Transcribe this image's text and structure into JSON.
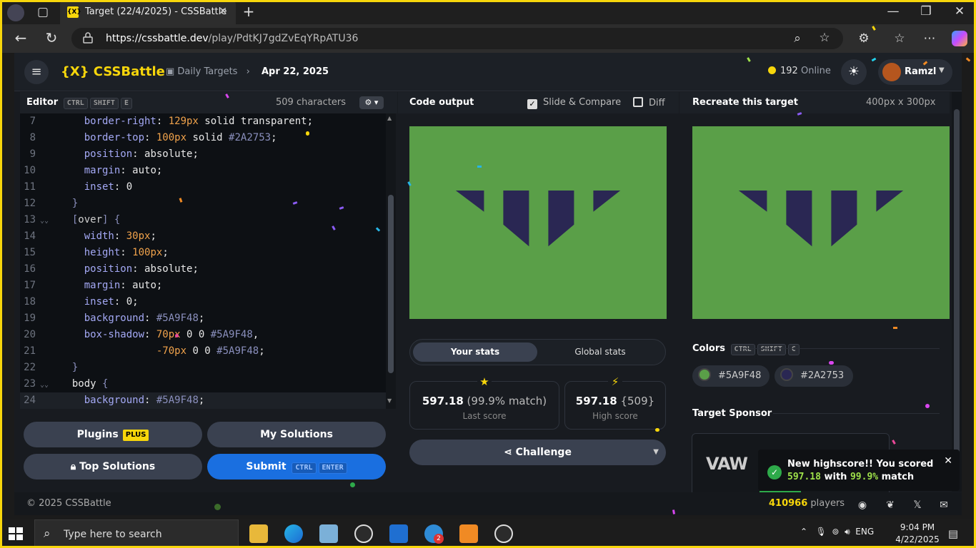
{
  "browser": {
    "tab_title": "Target (22/4/2025) - CSSBattle",
    "tab_icon": "cssbattle-favicon",
    "url_host": "https://cssbattle.dev",
    "url_path": "/play/PdtKJ7gdZvEqYRpATU36",
    "nav_glyphs": {
      "back": "←",
      "reload": "↻",
      "minimize": "—",
      "maximize": "❐",
      "close": "✕",
      "new_tab": "+"
    }
  },
  "header": {
    "logo": "{X} CSSBattle",
    "breadcrumb": "Daily Targets",
    "separator": "›",
    "date": "Apr 22, 2025",
    "online_count": "192",
    "online_label": "Online",
    "user_name": "Ramzl"
  },
  "editor": {
    "title": "Editor",
    "shortcut": [
      "CTRL",
      "SHIFT",
      "E"
    ],
    "char_count": "509 characters",
    "lines": [
      {
        "n": "7",
        "parts": [
          [
            "prop",
            "    border-right"
          ],
          [
            "kw",
            ": "
          ],
          [
            "num",
            "129px"
          ],
          [
            "kw",
            " solid transparent;"
          ]
        ]
      },
      {
        "n": "8",
        "parts": [
          [
            "prop",
            "    border-top"
          ],
          [
            "kw",
            ": "
          ],
          [
            "num",
            "100px"
          ],
          [
            "kw",
            " solid "
          ],
          [
            "str",
            "#2A2753"
          ],
          [
            "kw",
            ";"
          ]
        ]
      },
      {
        "n": "9",
        "parts": [
          [
            "prop",
            "    position"
          ],
          [
            "kw",
            ": absolute;"
          ]
        ]
      },
      {
        "n": "10",
        "parts": [
          [
            "prop",
            "    margin"
          ],
          [
            "kw",
            ": auto;"
          ]
        ]
      },
      {
        "n": "11",
        "parts": [
          [
            "prop",
            "    inset"
          ],
          [
            "kw",
            ": 0"
          ]
        ]
      },
      {
        "n": "12",
        "parts": [
          [
            "str",
            "  }"
          ]
        ]
      },
      {
        "n": "13",
        "parts": [
          [
            "str",
            "  ["
          ],
          [
            "sel",
            "over"
          ],
          [
            "str",
            "] {"
          ]
        ]
      },
      {
        "n": "14",
        "parts": [
          [
            "prop",
            "    width"
          ],
          [
            "kw",
            ": "
          ],
          [
            "num",
            "30px"
          ],
          [
            "kw",
            ";"
          ]
        ]
      },
      {
        "n": "15",
        "parts": [
          [
            "prop",
            "    height"
          ],
          [
            "kw",
            ": "
          ],
          [
            "num",
            "100px"
          ],
          [
            "kw",
            ";"
          ]
        ]
      },
      {
        "n": "16",
        "parts": [
          [
            "prop",
            "    position"
          ],
          [
            "kw",
            ": absolute;"
          ]
        ]
      },
      {
        "n": "17",
        "parts": [
          [
            "prop",
            "    margin"
          ],
          [
            "kw",
            ": auto;"
          ]
        ]
      },
      {
        "n": "18",
        "parts": [
          [
            "prop",
            "    inset"
          ],
          [
            "kw",
            ": 0;"
          ]
        ]
      },
      {
        "n": "19",
        "parts": [
          [
            "prop",
            "    background"
          ],
          [
            "kw",
            ": "
          ],
          [
            "str",
            "#5A9F48"
          ],
          [
            "kw",
            ";"
          ]
        ]
      },
      {
        "n": "20",
        "parts": [
          [
            "prop",
            "    box-shadow"
          ],
          [
            "kw",
            ": "
          ],
          [
            "num",
            "70px"
          ],
          [
            "kw",
            " 0 0 "
          ],
          [
            "str",
            "#5A9F48"
          ],
          [
            "kw",
            ","
          ]
        ]
      },
      {
        "n": "21",
        "parts": [
          [
            "kw",
            "                "
          ],
          [
            "num",
            "-70px"
          ],
          [
            "kw",
            " 0 0 "
          ],
          [
            "str",
            "#5A9F48"
          ],
          [
            "kw",
            ";"
          ]
        ]
      },
      {
        "n": "22",
        "parts": [
          [
            "str",
            "  }"
          ]
        ]
      },
      {
        "n": "23",
        "parts": [
          [
            "kw",
            "  body "
          ],
          [
            "str",
            "{"
          ]
        ]
      },
      {
        "n": "24",
        "parts": [
          [
            "prop",
            "    background"
          ],
          [
            "kw",
            ": "
          ],
          [
            "str",
            "#5A9F48"
          ],
          [
            "kw",
            ";"
          ]
        ]
      }
    ],
    "fold_lines": [
      "13",
      "23"
    ],
    "current_line": "24"
  },
  "buttons": {
    "plugins": "Plugins",
    "plugins_badge": "PLUS",
    "my_solutions": "My Solutions",
    "top_solutions": "Top Solutions",
    "submit": "Submit",
    "submit_keys": [
      "CTRL",
      "ENTER"
    ],
    "challenge": "Challenge"
  },
  "output": {
    "title": "Code output",
    "slide_compare": "Slide & Compare",
    "slide_checked": true,
    "diff": "Diff",
    "diff_checked": false
  },
  "stats": {
    "tab_your": "Your stats",
    "tab_global": "Global stats",
    "last_score": "597.18",
    "last_match": "(99.9% match)",
    "last_label": "Last score",
    "high_score": "597.18",
    "high_chars": "{509}",
    "high_label": "High score"
  },
  "target": {
    "title": "Recreate this target",
    "size": "400px x 300px",
    "colors_title": "Colors",
    "colors_shortcut": [
      "CTRL",
      "SHIFT",
      "C"
    ],
    "colors": [
      {
        "hex": "#5A9F48",
        "label": "#5A9F48"
      },
      {
        "hex": "#2A2753",
        "label": "#2A2753"
      }
    ],
    "sponsor_title": "Target Sponsor",
    "sponsor_logo": "VAW"
  },
  "toast": {
    "line1": "New highscore!! You scored",
    "score": "597.18",
    "with": "with",
    "match": "99.9%",
    "match_suffix": "match"
  },
  "footer": {
    "copyright": "© 2025 CSSBattle",
    "players_count": "410966",
    "players_label": "players"
  },
  "taskbar": {
    "search_placeholder": "Type here to search",
    "language": "ENG",
    "time": "9:04 PM",
    "date": "4/22/2025",
    "notif_badge": "2"
  },
  "colors": {
    "accent": "#f7d60b",
    "primary": "#1a6fe0",
    "canvas_bg": "#5a9f48",
    "shape": "#2a2753"
  }
}
